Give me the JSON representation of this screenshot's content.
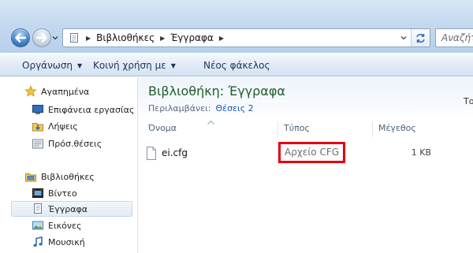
{
  "address": {
    "crumbs": [
      "Βιβλιοθήκες",
      "Έγγραφα"
    ]
  },
  "search": {
    "placeholder": "Αναζήτ"
  },
  "toolbar": {
    "organize": "Οργάνωση",
    "share": "Κοινή χρήση με",
    "new_folder": "Νέος φάκελος"
  },
  "sidebar": {
    "favorites_header": "Αγαπημένα",
    "favorites": [
      "Επιφάνεια εργασίας",
      "Λήψεις",
      "Πρόσ.θέσεις"
    ],
    "libraries_header": "Βιβλιοθήκες",
    "libraries": [
      "Βίντεο",
      "Έγγραφα",
      "Εικόνες",
      "Μουσική"
    ]
  },
  "library": {
    "title": "Βιβλιοθήκη: Έγγραφα",
    "includes_label": "Περιλαμβάνει:",
    "locations_link": "Θέσεις 2",
    "arrange_cut": "Το"
  },
  "columns": {
    "name": "Όνομα",
    "type": "Τύπος",
    "size": "Μέγεθος"
  },
  "files": [
    {
      "name": "ei.cfg",
      "type": "Αρχείο CFG",
      "size": "1 KB"
    }
  ],
  "highlight_color": "#e3000f",
  "title_color": "#1e5f2a"
}
